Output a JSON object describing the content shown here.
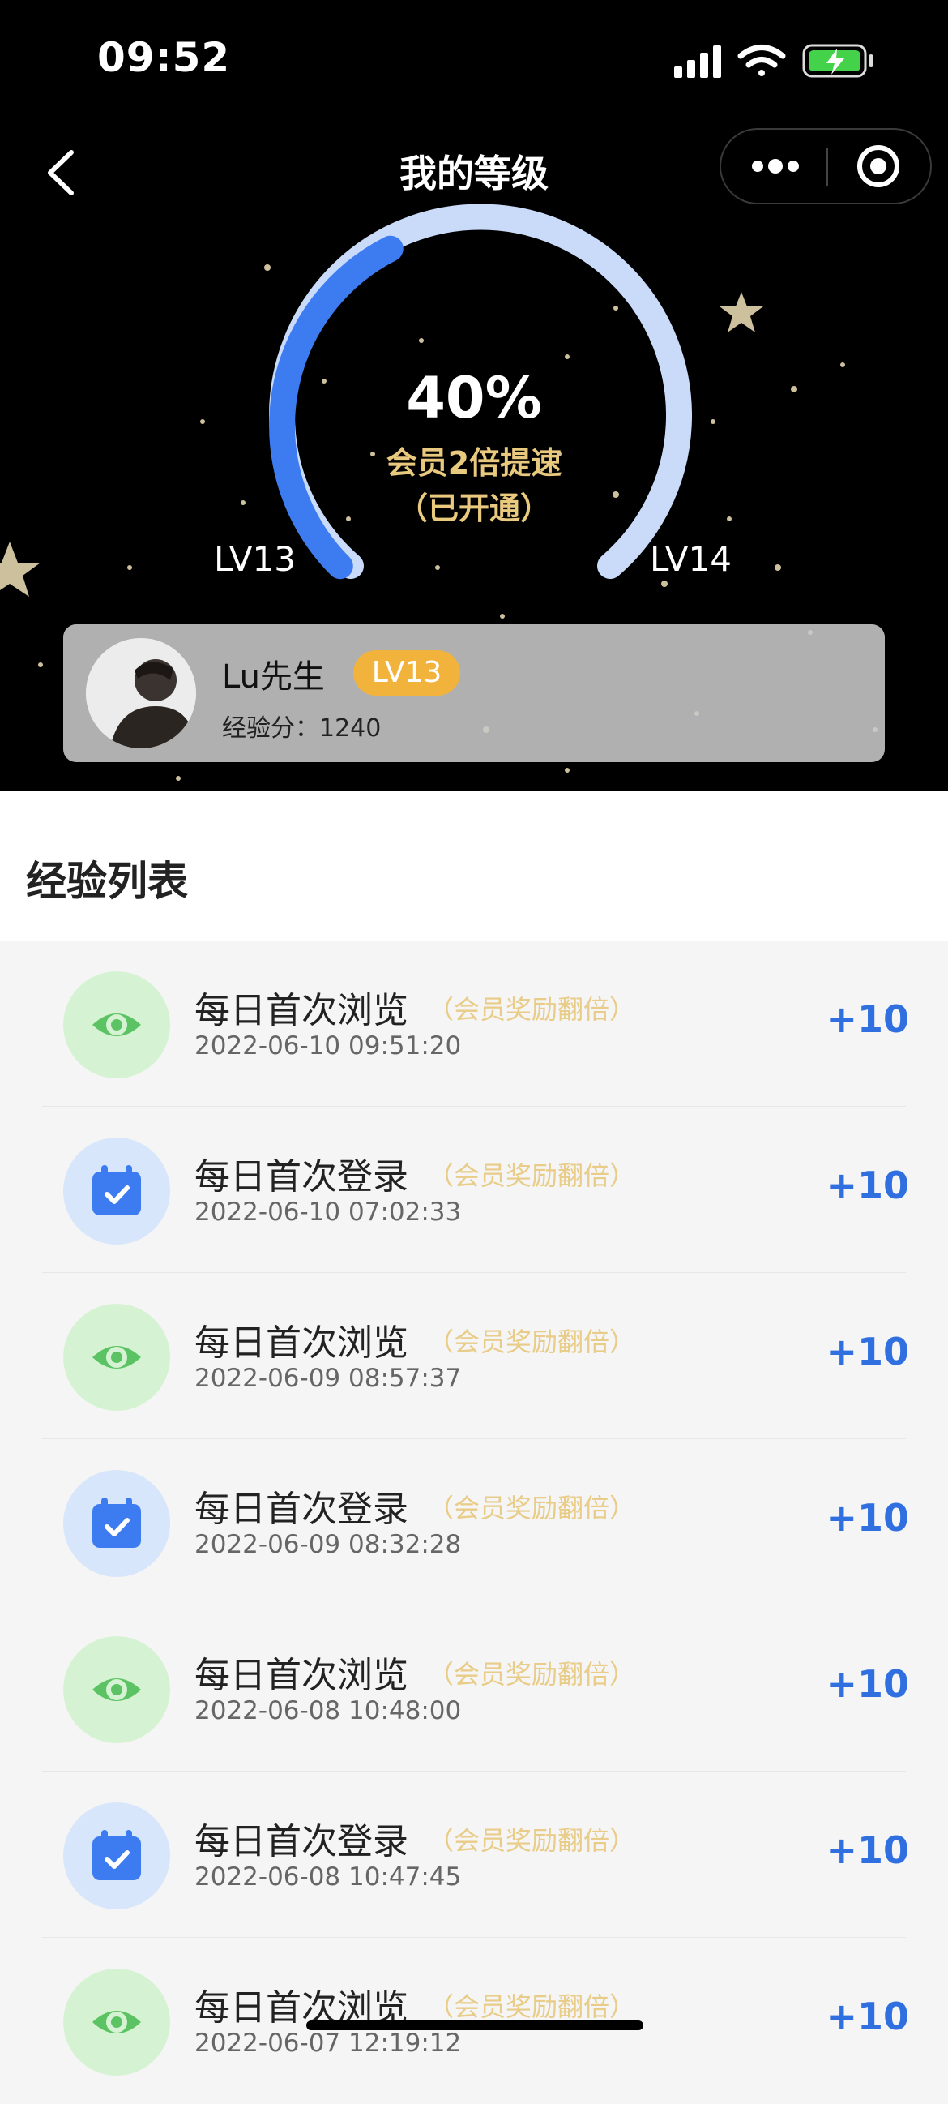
{
  "status_bar": {
    "time": "09:52"
  },
  "nav": {
    "title": "我的等级"
  },
  "progress": {
    "percent_text": "40%",
    "value": 0.4,
    "speed_text": "会员2倍提速",
    "activated_text": "（已开通）",
    "current_level": "LV13",
    "next_level": "LV14"
  },
  "user": {
    "name": "Lu先生",
    "level": "LV13",
    "exp_text": "经验分：1240"
  },
  "list": {
    "title": "经验列表",
    "items": [
      {
        "icon": "eye-icon",
        "title": "每日首次浏览",
        "note": "（会员奖励翻倍）",
        "time": "2022-06-10 09:51:20",
        "points": "+10"
      },
      {
        "icon": "calendar-check-icon",
        "title": "每日首次登录",
        "note": "（会员奖励翻倍）",
        "time": "2022-06-10 07:02:33",
        "points": "+10"
      },
      {
        "icon": "eye-icon",
        "title": "每日首次浏览",
        "note": "（会员奖励翻倍）",
        "time": "2022-06-09 08:57:37",
        "points": "+10"
      },
      {
        "icon": "calendar-check-icon",
        "title": "每日首次登录",
        "note": "（会员奖励翻倍）",
        "time": "2022-06-09 08:32:28",
        "points": "+10"
      },
      {
        "icon": "eye-icon",
        "title": "每日首次浏览",
        "note": "（会员奖励翻倍）",
        "time": "2022-06-08 10:48:00",
        "points": "+10"
      },
      {
        "icon": "calendar-check-icon",
        "title": "每日首次登录",
        "note": "（会员奖励翻倍）",
        "time": "2022-06-08 10:47:45",
        "points": "+10"
      },
      {
        "icon": "eye-icon",
        "title": "每日首次浏览",
        "note": "（会员奖励翻倍）",
        "time": "2022-06-07 12:19:12",
        "points": "+10"
      }
    ]
  },
  "colors": {
    "progress_fill": "#3d7cf0",
    "progress_track": "#c9dbf9",
    "points": "#2f6fe0",
    "badge": "#f2b33d",
    "note": "#e8cc87"
  }
}
